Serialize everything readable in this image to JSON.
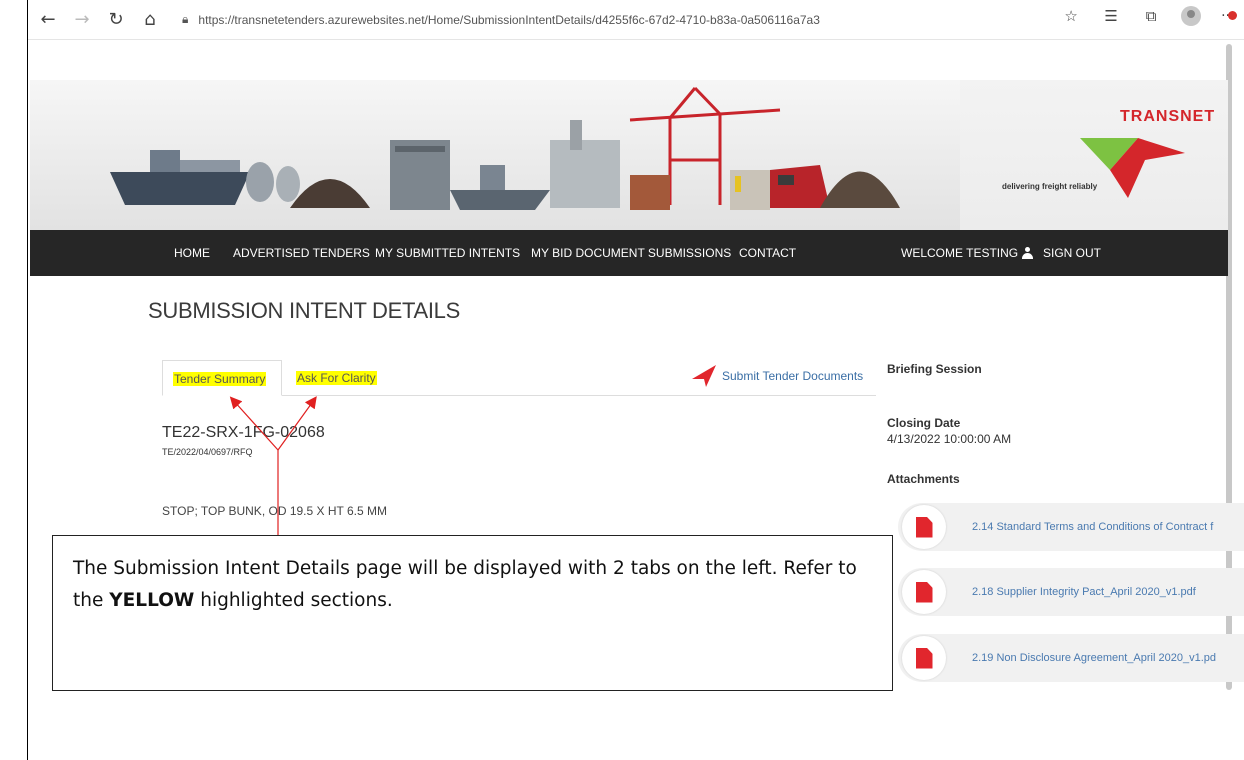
{
  "browser": {
    "url": "https://transnetetenders.azurewebsites.net/Home/SubmissionIntentDetails/d4255f6c-67d2-4710-b83a-0a506116a7a3"
  },
  "logo": {
    "name": "TRANSNET",
    "tagline": "delivering freight reliably"
  },
  "nav": {
    "home": "HOME",
    "advertised": "ADVERTISED TENDERS",
    "my_intents": "MY SUBMITTED INTENTS",
    "my_bids": "MY BID DOCUMENT SUBMISSIONS",
    "contact": "CONTACT",
    "welcome": "WELCOME TESTING",
    "signout": "SIGN OUT"
  },
  "page": {
    "title": "SUBMISSION INTENT DETAILS",
    "tabs": [
      "Tender Summary",
      "Ask For Clarity"
    ],
    "submit_link": "Submit Tender Documents",
    "tender_number": "TE22-SRX-1FG-02068",
    "tender_ref": "TE/2022/04/0697/RFQ",
    "tender_desc": "STOP; TOP BUNK, OD 19.5 X HT 6.5 MM"
  },
  "sidebar": {
    "briefing_label": "Briefing Session",
    "closing_label": "Closing Date",
    "closing_value": "4/13/2022 10:00:00 AM",
    "attachments_label": "Attachments",
    "attachments": [
      "2.14 Standard Terms and Conditions of Contract f",
      "2.18 Supplier Integrity Pact_April 2020_v1.pdf",
      "2.19 Non Disclosure Agreement_April 2020_v1.pd"
    ]
  },
  "annotation": {
    "text_before": "The Submission Intent Details page will be displayed with 2 tabs on the left. Refer to the ",
    "bold": "YELLOW",
    "text_after": " highlighted sections."
  },
  "colors": {
    "nav_bg": "#262626",
    "brand_red": "#d4262b",
    "brand_green": "#7dc242",
    "highlight": "#ffff00",
    "link": "#3a6ea5"
  }
}
